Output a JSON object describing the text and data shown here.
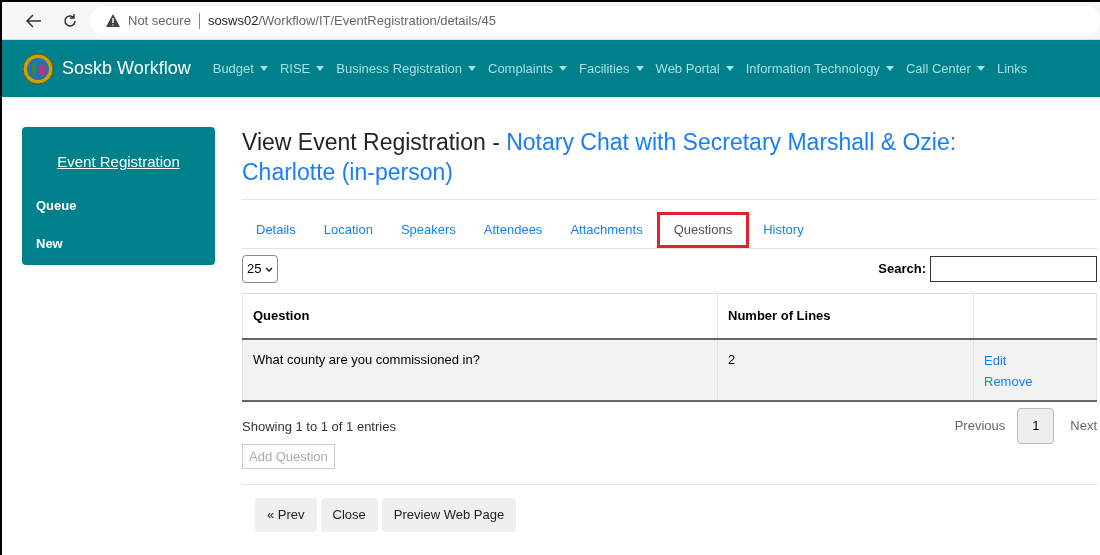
{
  "browser": {
    "security": "Not secure",
    "url_host": "sosws02",
    "url_path": "/Workflow/IT/EventRegistration/details/45"
  },
  "navbar": {
    "brand": "Soskb Workflow",
    "items": [
      {
        "label": "Budget",
        "dropdown": true
      },
      {
        "label": "RISE",
        "dropdown": true
      },
      {
        "label": "Business Registration",
        "dropdown": true
      },
      {
        "label": "Complaints",
        "dropdown": true
      },
      {
        "label": "Facilities",
        "dropdown": true
      },
      {
        "label": "Web Portal",
        "dropdown": true
      },
      {
        "label": "Information Technology",
        "dropdown": true
      },
      {
        "label": "Call Center",
        "dropdown": true
      },
      {
        "label": "Links",
        "dropdown": false
      }
    ]
  },
  "sidebar": {
    "title": "Event Registration",
    "items": [
      "Queue",
      "New"
    ]
  },
  "page": {
    "title": "View Event Registration",
    "separator": " - ",
    "event_name": "Notary Chat with Secretary Marshall & Ozie: Charlotte (in-person)"
  },
  "tabs": [
    {
      "label": "Details",
      "selected": false,
      "highlighted": false
    },
    {
      "label": "Location",
      "selected": false,
      "highlighted": false
    },
    {
      "label": "Speakers",
      "selected": false,
      "highlighted": false
    },
    {
      "label": "Attendees",
      "selected": false,
      "highlighted": false
    },
    {
      "label": "Attachments",
      "selected": false,
      "highlighted": false
    },
    {
      "label": "Questions",
      "selected": true,
      "highlighted": true
    },
    {
      "label": "History",
      "selected": false,
      "highlighted": false
    }
  ],
  "page_length": "25",
  "search_label": "Search:",
  "table": {
    "columns": [
      "Question",
      "Number of Lines"
    ],
    "rows": [
      {
        "question": "What county are you commissioned in?",
        "lines": "2",
        "actions": [
          "Edit",
          "Remove"
        ]
      }
    ]
  },
  "info": "Showing 1 to 1 of 1 entries",
  "pagination": {
    "previous": "Previous",
    "pages": [
      {
        "label": "1",
        "selected": true
      }
    ],
    "next": "Next"
  },
  "add_button": {
    "label": "Add Question",
    "disabled": true
  },
  "footer_buttons": [
    "« Prev",
    "Close",
    "Preview Web Page"
  ]
}
